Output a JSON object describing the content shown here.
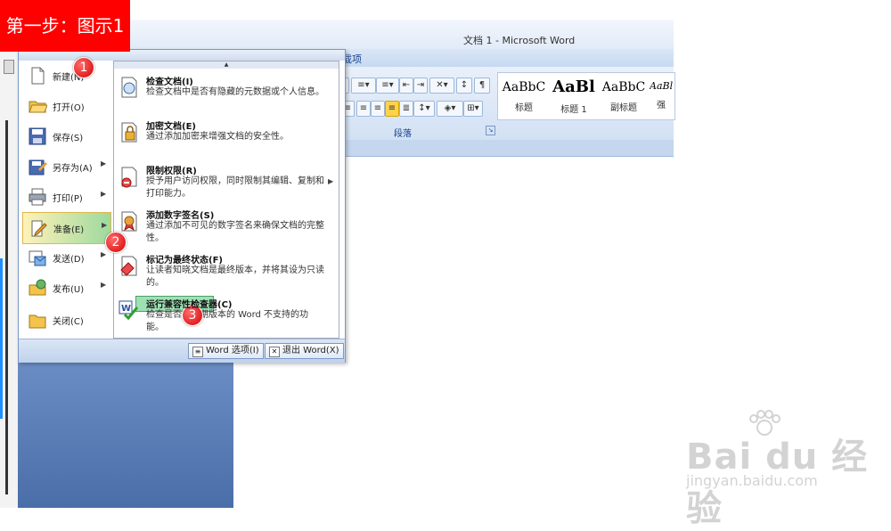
{
  "caption": "第一步：图示1",
  "window": {
    "title": "文档 1 - Microsoft Word",
    "tab_fragment": "载项"
  },
  "ribbon": {
    "paragraph_group": "段落",
    "styles": [
      {
        "sample": "AaBbC",
        "label": "标题"
      },
      {
        "sample": "AaBl",
        "label": "标题 1"
      },
      {
        "sample": "AaBbC",
        "label": "副标题"
      },
      {
        "sample": "AaBl",
        "label": "强"
      }
    ]
  },
  "menu": {
    "left_items": [
      {
        "label": "新建(N)",
        "icon": "new-document-icon",
        "submenu": false
      },
      {
        "label": "打开(O)",
        "icon": "open-folder-icon",
        "submenu": false
      },
      {
        "label": "保存(S)",
        "icon": "save-disk-icon",
        "submenu": false
      },
      {
        "label": "另存为(A)",
        "icon": "save-as-icon",
        "submenu": true
      },
      {
        "label": "打印(P)",
        "icon": "printer-icon",
        "submenu": true
      },
      {
        "label": "准备(E)",
        "icon": "prepare-pencil-icon",
        "submenu": true,
        "selected": true
      },
      {
        "label": "发送(D)",
        "icon": "send-mail-icon",
        "submenu": true
      },
      {
        "label": "发布(U)",
        "icon": "publish-icon",
        "submenu": true
      },
      {
        "label": "关闭(C)",
        "icon": "close-folder-icon",
        "submenu": false
      }
    ],
    "right_items": [
      {
        "title": "检查文档(I)",
        "desc": "检查文档中是否有隐藏的元数据或个人信息。",
        "icon": "inspect-document-icon"
      },
      {
        "title": "加密文档(E)",
        "desc": "通过添加加密来增强文档的安全性。",
        "icon": "encrypt-lock-icon"
      },
      {
        "title": "限制权限(R)",
        "desc": "授予用户访问权限，同时限制其编辑、复制和打印能力。",
        "icon": "restrict-permission-icon",
        "submenu": true
      },
      {
        "title": "添加数字签名(S)",
        "desc": "通过添加不可见的数字签名来确保文档的完整性。",
        "icon": "digital-signature-icon"
      },
      {
        "title": "标记为最终状态(F)",
        "desc": "让读者知晓文档是最终版本，并将其设为只读的。",
        "icon": "mark-final-icon"
      },
      {
        "title": "运行兼容性检查器(C)",
        "desc": "检查是否有早期版本的 Word 不支持的功能。",
        "icon": "compatibility-checker-icon"
      }
    ],
    "word_options": "Word 选项(I)",
    "exit_word": "退出 Word(X)"
  },
  "markers": [
    "1",
    "2",
    "3"
  ],
  "watermark": {
    "logo": "Bai du 经验",
    "url": "jingyan.baidu.com"
  },
  "colors": {
    "caption_bg": "#ff0000",
    "marker": "#d40000",
    "selected_item": "#9ed99e"
  }
}
